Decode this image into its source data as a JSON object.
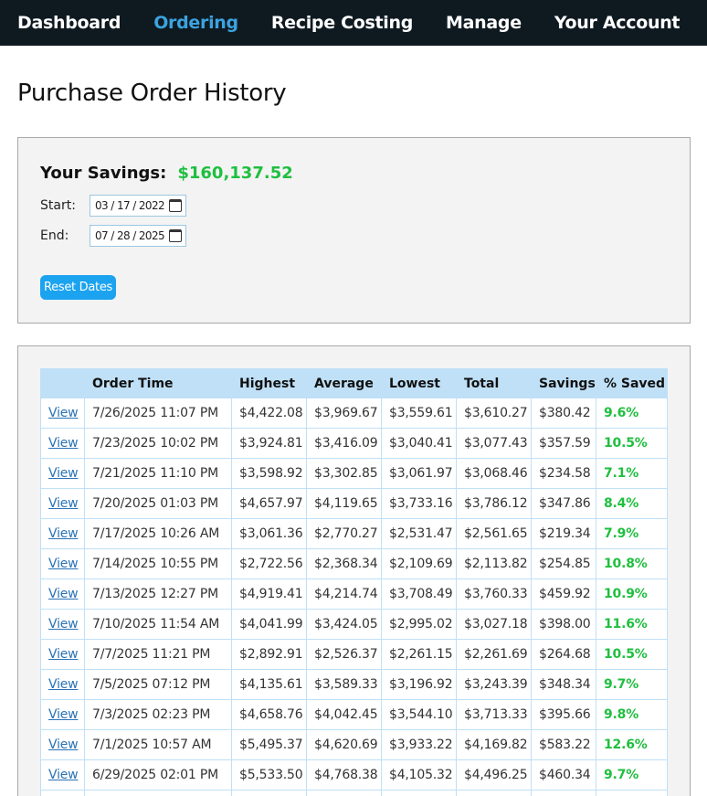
{
  "nav": {
    "items": [
      {
        "label": "Dashboard",
        "active": false
      },
      {
        "label": "Ordering",
        "active": true
      },
      {
        "label": "Recipe Costing",
        "active": false
      },
      {
        "label": "Manage",
        "active": false
      },
      {
        "label": "Your Account",
        "active": false
      }
    ]
  },
  "page": {
    "title": "Purchase Order History"
  },
  "savings": {
    "label": "Your Savings:",
    "value": "$160,137.52",
    "start_label": "Start:",
    "start_value": "03 / 17 / 2022",
    "end_label": "End:",
    "end_value": "07 / 28 / 2025",
    "reset_label": "Reset Dates"
  },
  "colors": {
    "nav_bg": "#0f1a20",
    "nav_active": "#3ba3e0",
    "positive": "#1fbf3f",
    "button": "#1ca3f0",
    "table_header": "#bfe0f7"
  },
  "table": {
    "headers": [
      "",
      "Order Time",
      "Highest",
      "Average",
      "Lowest",
      "Total",
      "Savings",
      "% Saved"
    ],
    "view_label": "View",
    "rows": [
      [
        "7/26/2025 11:07 PM",
        "$4,422.08",
        "$3,969.67",
        "$3,559.61",
        "$3,610.27",
        "$380.42",
        "9.6%"
      ],
      [
        "7/23/2025 10:02 PM",
        "$3,924.81",
        "$3,416.09",
        "$3,040.41",
        "$3,077.43",
        "$357.59",
        "10.5%"
      ],
      [
        "7/21/2025 11:10 PM",
        "$3,598.92",
        "$3,302.85",
        "$3,061.97",
        "$3,068.46",
        "$234.58",
        "7.1%"
      ],
      [
        "7/20/2025 01:03 PM",
        "$4,657.97",
        "$4,119.65",
        "$3,733.16",
        "$3,786.12",
        "$347.86",
        "8.4%"
      ],
      [
        "7/17/2025 10:26 AM",
        "$3,061.36",
        "$2,770.27",
        "$2,531.47",
        "$2,561.65",
        "$219.34",
        "7.9%"
      ],
      [
        "7/14/2025 10:55 PM",
        "$2,722.56",
        "$2,368.34",
        "$2,109.69",
        "$2,113.82",
        "$254.85",
        "10.8%"
      ],
      [
        "7/13/2025 12:27 PM",
        "$4,919.41",
        "$4,214.74",
        "$3,708.49",
        "$3,760.33",
        "$459.92",
        "10.9%"
      ],
      [
        "7/10/2025 11:54 AM",
        "$4,041.99",
        "$3,424.05",
        "$2,995.02",
        "$3,027.18",
        "$398.00",
        "11.6%"
      ],
      [
        "7/7/2025 11:21 PM",
        "$2,892.91",
        "$2,526.37",
        "$2,261.15",
        "$2,261.69",
        "$264.68",
        "10.5%"
      ],
      [
        "7/5/2025 07:12 PM",
        "$4,135.61",
        "$3,589.33",
        "$3,196.92",
        "$3,243.39",
        "$348.34",
        "9.7%"
      ],
      [
        "7/3/2025 02:23 PM",
        "$4,658.76",
        "$4,042.45",
        "$3,544.10",
        "$3,713.33",
        "$395.66",
        "9.8%"
      ],
      [
        "7/1/2025 10:57 AM",
        "$5,495.37",
        "$4,620.69",
        "$3,933.22",
        "$4,169.82",
        "$583.22",
        "12.6%"
      ],
      [
        "6/29/2025 02:01 PM",
        "$5,533.50",
        "$4,768.38",
        "$4,105.32",
        "$4,496.25",
        "$460.34",
        "9.7%"
      ],
      [
        "",
        "",
        "",
        "",
        "",
        "",
        ""
      ]
    ]
  }
}
